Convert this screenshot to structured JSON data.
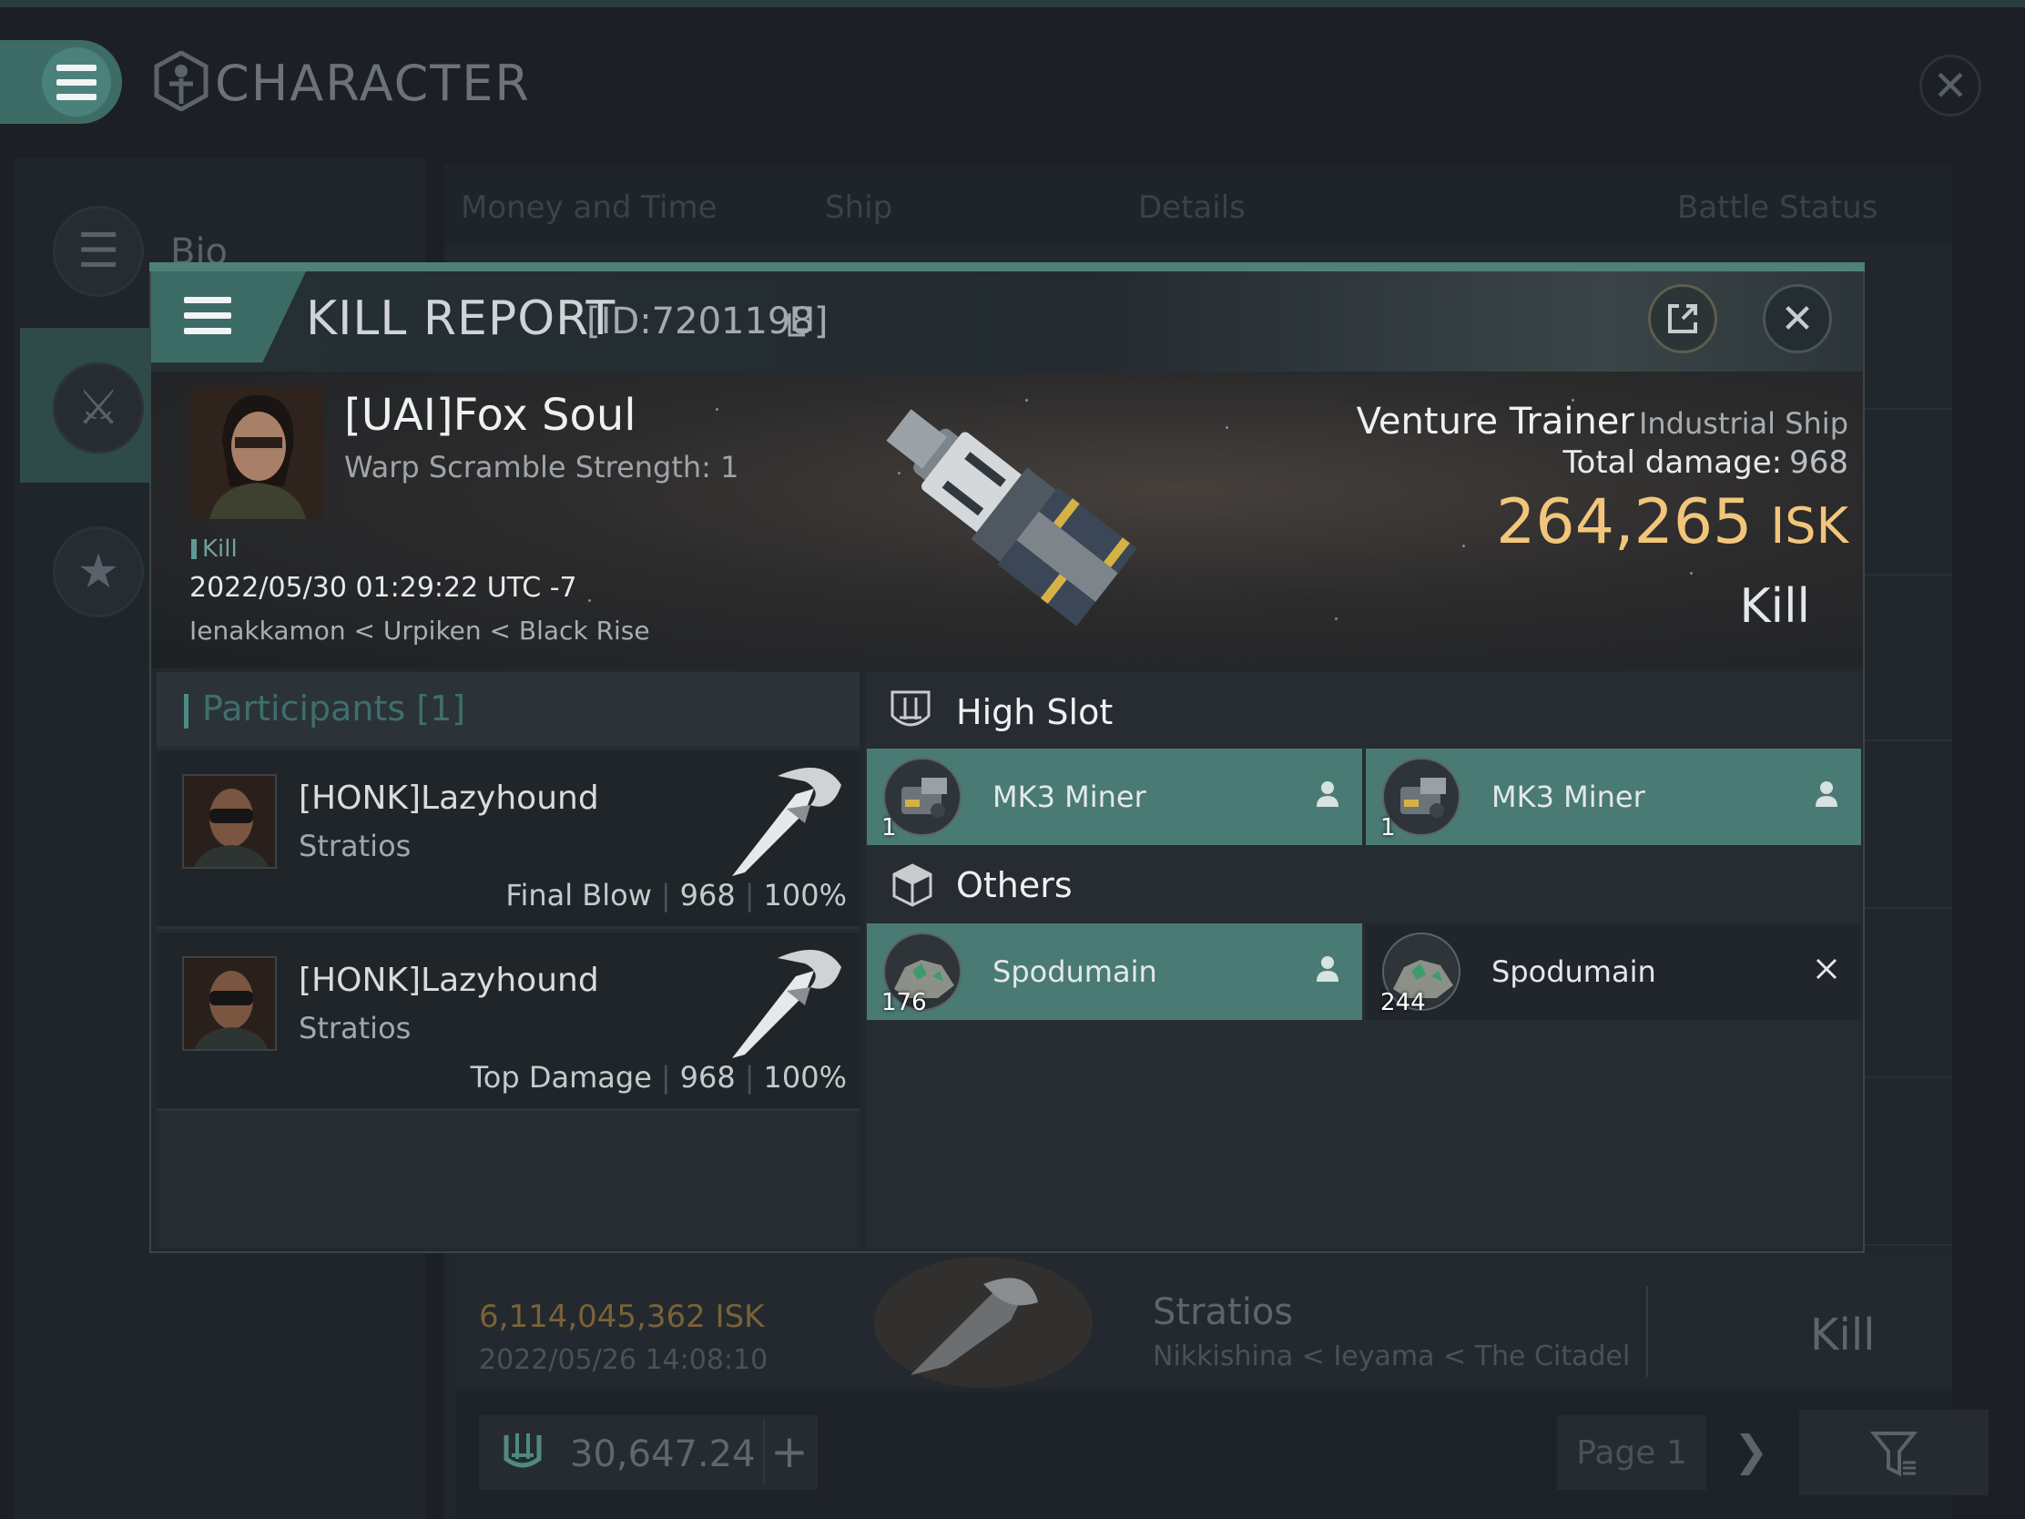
{
  "background": {
    "window_title": "CHARACTER",
    "sidebar": [
      {
        "label": "Bio",
        "icon": "list-icon"
      },
      {
        "label": "",
        "icon": "crossed-swords-icon"
      },
      {
        "label": "",
        "icon": "star-badge-icon"
      }
    ],
    "tabs": [
      "Money and Time",
      "Ship",
      "Details",
      "Battle Status"
    ],
    "kill_row": {
      "isk": "6,114,045,362  ISK",
      "date": "2022/05/26  14:08:10",
      "ship": "Stratios",
      "location": "Nikkishina < Ieyama < The Citadel",
      "status": "Kill"
    },
    "wallet": "30,647.24",
    "page": "Page 1"
  },
  "modal": {
    "title": "KILL REPORT",
    "id": "[ID:7201198]",
    "victim": {
      "name": "[UAI]Fox Soul",
      "warp": "Warp Scramble Strength: 1",
      "tag": "Kill",
      "date": "2022/05/30 01:29:22 UTC -7",
      "location": "Ienakkamon < Urpiken < Black Rise",
      "ship_name": "Venture Trainer",
      "ship_class": "Industrial Ship",
      "total_damage_label": "Total damage:",
      "total_damage": "968",
      "isk_value": "264,265",
      "isk_unit": "ISK",
      "status": "Kill"
    },
    "participants_title": "Participants [1]",
    "participants": [
      {
        "name": "[HONK]Lazyhound",
        "ship": "Stratios",
        "role": "Final Blow",
        "damage": "968",
        "percent": "100%"
      },
      {
        "name": "[HONK]Lazyhound",
        "ship": "Stratios",
        "role": "Top Damage",
        "damage": "968",
        "percent": "100%"
      }
    ],
    "groups": [
      {
        "title": "High Slot",
        "icon": "high-slot-icon",
        "items": [
          {
            "name": "MK3 Miner",
            "qty": "1",
            "state": "dropped-person-icon"
          },
          {
            "name": "MK3 Miner",
            "qty": "1",
            "state": "dropped-person-icon"
          }
        ]
      },
      {
        "title": "Others",
        "icon": "cargo-box-icon",
        "items": [
          {
            "name": "Spodumain",
            "qty": "176",
            "state": "dropped-person-icon"
          },
          {
            "name": "Spodumain",
            "qty": "244",
            "state": "destroyed-x-icon"
          }
        ]
      }
    ],
    "colors": {
      "accent": "#4a7a74",
      "isk": "#f2c67a",
      "panel": "#262c31"
    }
  }
}
